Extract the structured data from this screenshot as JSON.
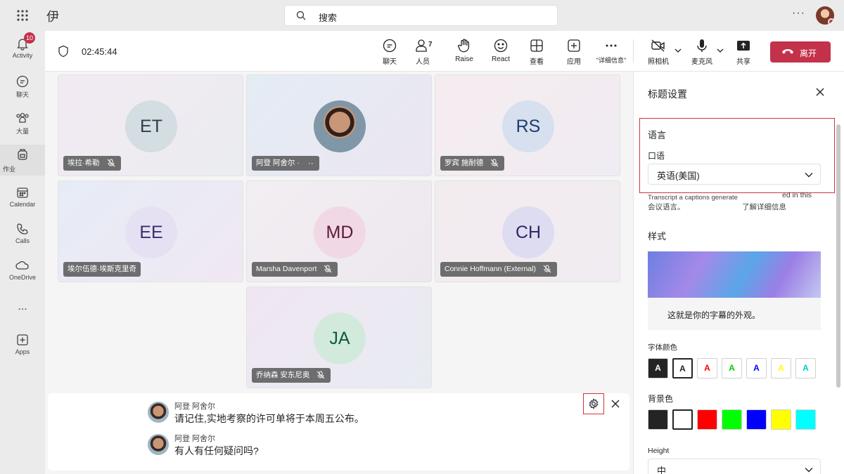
{
  "app": {
    "title": "伊"
  },
  "search": {
    "label": "搜索"
  },
  "rail": [
    {
      "label": "Activity",
      "badge": "10"
    },
    {
      "label": "聊天"
    },
    {
      "label": "大量"
    },
    {
      "label": "作业"
    },
    {
      "label": "Calendar"
    },
    {
      "label": "Calls"
    },
    {
      "label": "OneDrive"
    },
    {
      "label": "..."
    },
    {
      "label": "Apps"
    }
  ],
  "meeting": {
    "timer": "02:45:44",
    "buttons": {
      "chat": "聊天",
      "people": "人员",
      "people_count": "7",
      "raise": "Raise",
      "react": "React",
      "view": "查看",
      "apps": "应用",
      "more": "\"详细信息\"",
      "camera": "照相机",
      "mic": "麦克风",
      "share": "共享",
      "leave": "离开"
    }
  },
  "participants": [
    {
      "initials": "ET",
      "name": "埃拉·希勒",
      "color": "#2f3b4c",
      "bg": "#d3dde2"
    },
    {
      "initials": "",
      "name": "阿登 阿舍尔 ·",
      "color": "#fff",
      "bg": "#5a6b78"
    },
    {
      "initials": "RS",
      "name": "罗宾 施耐德",
      "color": "#1f3c72",
      "bg": "#d6e0ee"
    },
    {
      "initials": "EE",
      "name": "埃尔伍德·埃斯克里奇",
      "color": "#3a2e6e",
      "bg": "#e6e1f2"
    },
    {
      "initials": "MD",
      "name": "Marsha Davenport",
      "color": "#5c1a3e",
      "bg": "#f0d8e4"
    },
    {
      "initials": "CH",
      "name": "Connie Hoffmann (External)",
      "color": "#2c2a6a",
      "bg": "#dedcf0"
    },
    {
      "initials": "JA",
      "name": "乔纳森 安东尼奥",
      "color": "#0e5a36",
      "bg": "#d2eadb"
    }
  ],
  "captions": [
    {
      "speaker": "阿登 阿舍尔",
      "text": "请记住,实地考察的许可单将于本周五公布。"
    },
    {
      "speaker": "阿登 阿舍尔",
      "text": "有人有任何疑问吗?"
    }
  ],
  "panel": {
    "title": "标题设置",
    "language_heading": "语言",
    "spoken_label": "口语",
    "spoken_value": "英语(美国)",
    "desc_line1a": "Transcript a captions generate",
    "desc_line1b": "ed in this",
    "desc_line2a": "会议语言。",
    "desc_line2b": "了解详细信息",
    "style_heading": "样式",
    "preview_text": "这就是你的字幕的外观。",
    "font_color_label": "字体颜色",
    "font_colors": [
      "#ffffff",
      "#242424",
      "#ff0000",
      "#00cc00",
      "#0000ff",
      "#ffff00",
      "#00cccc"
    ],
    "font_swatch_char": "A",
    "bg_color_label": "背景色",
    "bg_colors": [
      "#242424",
      "#ffffff",
      "#ff0000",
      "#00ff00",
      "#0000ff",
      "#ffff00",
      "#00ffff"
    ],
    "height_label": "Height",
    "height_value": "中"
  }
}
